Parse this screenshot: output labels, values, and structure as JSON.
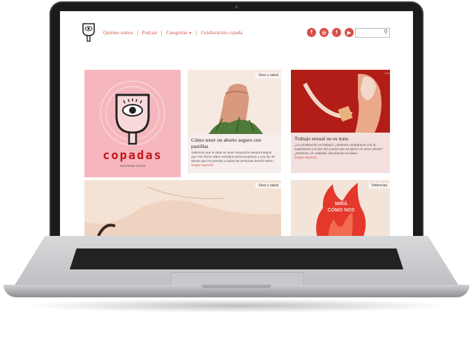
{
  "nav": {
    "items": [
      {
        "label": "Quiénes somos"
      },
      {
        "label": "Podcast"
      },
      {
        "label": "Categorías"
      },
      {
        "label": "Colaboración copada"
      }
    ]
  },
  "social": {
    "icons": [
      "facebook-icon",
      "instagram-icon",
      "twitter-icon",
      "youtube-icon"
    ],
    "color": "#d9504a"
  },
  "search": {
    "placeholder": ""
  },
  "brand": {
    "name": "copadas",
    "tagline": "NOS PASAN COSAS"
  },
  "cards": [
    {
      "category": "Sexo y salud",
      "title": "Cómo tener un aborto seguro con pastillas",
      "excerpt": "Sabemos que lo ideal es tener educación sexual integral que nos forme sobre métodos anticonceptivos y una ley de aborto que les permita a todas las personas decidir sobre...",
      "more": "Seguir leyendo"
    },
    {
      "category": "",
      "title": "Trabajo sexual no es trata",
      "excerpt": "¿La prostitución es trabajo? ¿Debería compararse con la explotación y el uso del cuerpo que se ejerce en otros rubros? ¿Estamos, en realidad, discutiendo en base...",
      "more": "Seguir leyendo"
    },
    {
      "category": "Sexo y salud"
    },
    {
      "category": "Violencias",
      "art_text": "MIRÁ CÓMO NOS"
    }
  ],
  "colors": {
    "accent": "#d2554d",
    "brand_red": "#c2161d",
    "card_pink": "#f5b7bd",
    "card_red": "#b21d18"
  }
}
